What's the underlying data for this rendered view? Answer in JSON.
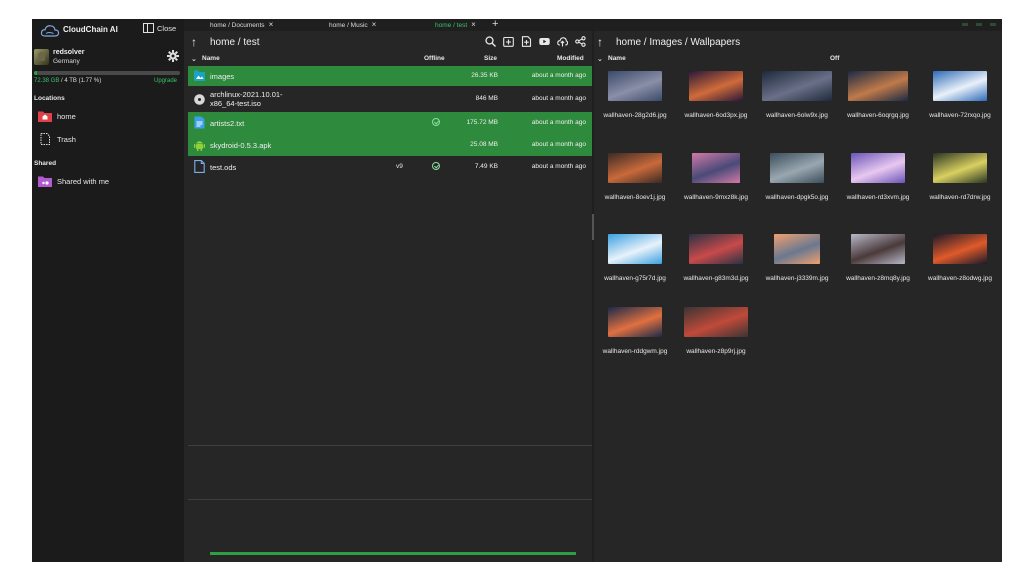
{
  "app": {
    "title": "CloudChain AI",
    "close_label": "Close",
    "accent": "#2ea043"
  },
  "user": {
    "name": "redsolver",
    "country": "Germany",
    "storage_used": "72.38 GB",
    "storage_rest": " / 4 TB (1.77 %)",
    "storage_percent": 1.77,
    "upgrade_label": "Upgrade"
  },
  "sidebar": {
    "locations_label": "Locations",
    "shared_label": "Shared",
    "locations": [
      {
        "label": "home",
        "icon": "folder-home-icon"
      },
      {
        "label": "Trash",
        "icon": "trash-icon"
      }
    ],
    "shared": [
      {
        "label": "Shared with me",
        "icon": "shared-folder-icon"
      }
    ]
  },
  "tabs": [
    {
      "label": "home / Documents",
      "active": false
    },
    {
      "label": "home / Music",
      "active": false
    },
    {
      "label": "home / test",
      "active": true
    }
  ],
  "left_pane": {
    "path": "home  /  test",
    "columns": {
      "name": "Name",
      "offline": "Offline",
      "size": "Size",
      "modified": "Modified"
    },
    "files": [
      {
        "name": "images",
        "version": "",
        "offline": false,
        "size": "26.35 KB",
        "modified": "about a month ago",
        "selected": true,
        "icon": "image-folder-icon"
      },
      {
        "name": "archlinux-2021.10.01-x86_64-test.iso",
        "line1": "archlinux-2021.10.01-",
        "line2": "x86_64-test.iso",
        "version": "",
        "offline": false,
        "size": "846 MB",
        "modified": "about a month ago",
        "selected": false,
        "icon": "disc-icon"
      },
      {
        "name": "artists2.txt",
        "version": "",
        "offline": true,
        "size": "175.72 MB",
        "modified": "about a month ago",
        "selected": true,
        "icon": "text-file-icon"
      },
      {
        "name": "skydroid-0.5.3.apk",
        "version": "",
        "offline": false,
        "size": "25.08 MB",
        "modified": "about a month ago",
        "selected": true,
        "icon": "android-icon"
      },
      {
        "name": "test.ods",
        "version": "v9",
        "offline": true,
        "size": "7.49 KB",
        "modified": "about a month ago",
        "selected": false,
        "icon": "file-icon"
      }
    ]
  },
  "right_pane": {
    "path": "home  /  Images  /  Wallpapers",
    "columns": {
      "name": "Name",
      "offline": "Off"
    },
    "images": [
      {
        "name": "wallhaven-28g2d6.jpg",
        "c1": "#3a4a6a",
        "c2": "#8b8fa8"
      },
      {
        "name": "wallhaven-6od3px.jpg",
        "c1": "#2a1838",
        "c2": "#d06b3a"
      },
      {
        "name": "wallhaven-6olw9x.jpg",
        "c1": "#1e2a3c",
        "c2": "#6a7088"
      },
      {
        "name": "wallhaven-6oqrgq.jpg",
        "c1": "#1a2a44",
        "c2": "#c07a4a"
      },
      {
        "name": "wallhaven-72rxqo.jpg",
        "c1": "#2e6ab8",
        "c2": "#e9f1fa"
      },
      {
        "name": "wallhaven-8oev1j.jpg",
        "c1": "#3a2a26",
        "c2": "#c96a3a"
      },
      {
        "name": "wallhaven-9mxz8k.jpg",
        "c1": "#d07aa8",
        "c2": "#4a4a78"
      },
      {
        "name": "wallhaven-dpgk5o.jpg",
        "c1": "#3a4e5a",
        "c2": "#9aa7b0"
      },
      {
        "name": "wallhaven-rd3xvm.jpg",
        "c1": "#6a54b8",
        "c2": "#e8c8f0"
      },
      {
        "name": "wallhaven-rd7drw.jpg",
        "c1": "#2a3424",
        "c2": "#d8d060"
      },
      {
        "name": "wallhaven-g75r7d.jpg",
        "c1": "#3aa0e0",
        "c2": "#e8f2fa"
      },
      {
        "name": "wallhaven-g83m3d.jpg",
        "c1": "#2a3244",
        "c2": "#c84a4a"
      },
      {
        "name": "wallhaven-j3339m.jpg",
        "c1": "#f0a070",
        "c2": "#6a7890"
      },
      {
        "name": "wallhaven-z8mq8y.jpg",
        "c1": "#b8b8c8",
        "c2": "#4a3a3a"
      },
      {
        "name": "wallhaven-z8odwg.jpg",
        "c1": "#1a1a2a",
        "c2": "#e05a2a"
      },
      {
        "name": "wallhaven-rddgwm.jpg",
        "c1": "#1a2a4a",
        "c2": "#e07040"
      },
      {
        "name": "wallhaven-z8p9rj.jpg",
        "c1": "#3a3434",
        "c2": "#c04a3a"
      }
    ]
  }
}
